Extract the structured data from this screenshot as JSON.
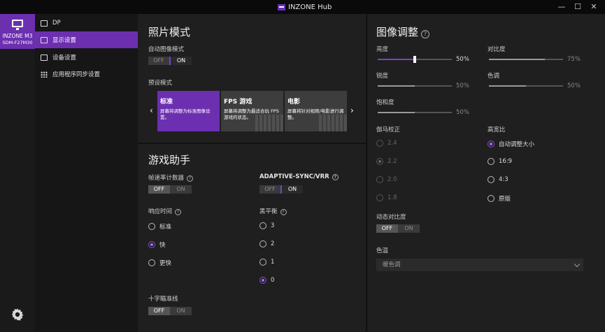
{
  "window": {
    "title": "INZONE Hub",
    "minimize": "—",
    "maximize": "☐",
    "close": "✕"
  },
  "device": {
    "name": "INZONE M3",
    "model": "SDM-F27M30"
  },
  "nav": {
    "items": [
      {
        "label": "DP",
        "icon": "input-icon"
      },
      {
        "label": "显示设置",
        "icon": "image-icon",
        "active": true
      },
      {
        "label": "设备设置",
        "icon": "monitor-icon"
      },
      {
        "label": "应用程序同步设置",
        "icon": "grid-icon"
      }
    ]
  },
  "photo_mode": {
    "title": "照片模式",
    "auto_label": "自动图像模式",
    "toggle_off": "OFF",
    "toggle_on": "ON",
    "auto_state": "ON",
    "preset_label": "预设模式",
    "presets": [
      {
        "title": "标准",
        "desc": "屏幕将调整为标准图像设置。",
        "selected": true
      },
      {
        "title": "FPS 游戏",
        "desc": "屏幕将调整为最适合玩 FPS 游戏的状态。"
      },
      {
        "title": "电影",
        "desc": "屏幕将针对视频/电影进行调整。"
      }
    ],
    "prev": "‹",
    "next": "›"
  },
  "game_assist": {
    "title": "游戏助手",
    "fps_counter_label": "帧速率计数器",
    "fps_counter_state": "OFF",
    "vrr_label": "ADAPTIVE-SYNC/VRR",
    "vrr_state": "ON",
    "response_label": "响应时间",
    "response_options": [
      "标准",
      "快",
      "更快"
    ],
    "response_selected": "快",
    "black_eq_label": "黑平衡",
    "black_eq_options": [
      "3",
      "2",
      "1",
      "0"
    ],
    "black_eq_selected": "0",
    "crosshair_label": "十字瞄准线",
    "crosshair_state": "OFF"
  },
  "image_adjust": {
    "title": "图像调整",
    "brightness_label": "亮度",
    "brightness_value": "50%",
    "brightness": 0.5,
    "contrast_label": "对比度",
    "contrast_value": "75%",
    "contrast": 0.75,
    "sharpness_label": "锐度",
    "sharpness_value": "50%",
    "sharpness": 0.5,
    "hue_label": "色调",
    "hue_value": "50%",
    "hue": 0.5,
    "saturation_label": "饱和度",
    "saturation_value": "50%",
    "saturation": 0.5,
    "gamma_label": "伽马校正",
    "gamma_options": [
      "2.4",
      "2.2",
      "2.0",
      "1.8"
    ],
    "gamma_selected": "2.2",
    "aspect_label": "高宽比",
    "aspect_options": [
      "自动调整大小",
      "16:9",
      "4:3",
      "原版"
    ],
    "aspect_selected": "自动调整大小",
    "dynamic_contrast_label": "动态对比度",
    "dynamic_contrast_state": "OFF",
    "color_temp_label": "色温",
    "color_temp_value": "暖色调"
  },
  "colors": {
    "accent": "#6c2fb0",
    "background": "#1f1f1f",
    "sidebar": "#161616"
  }
}
